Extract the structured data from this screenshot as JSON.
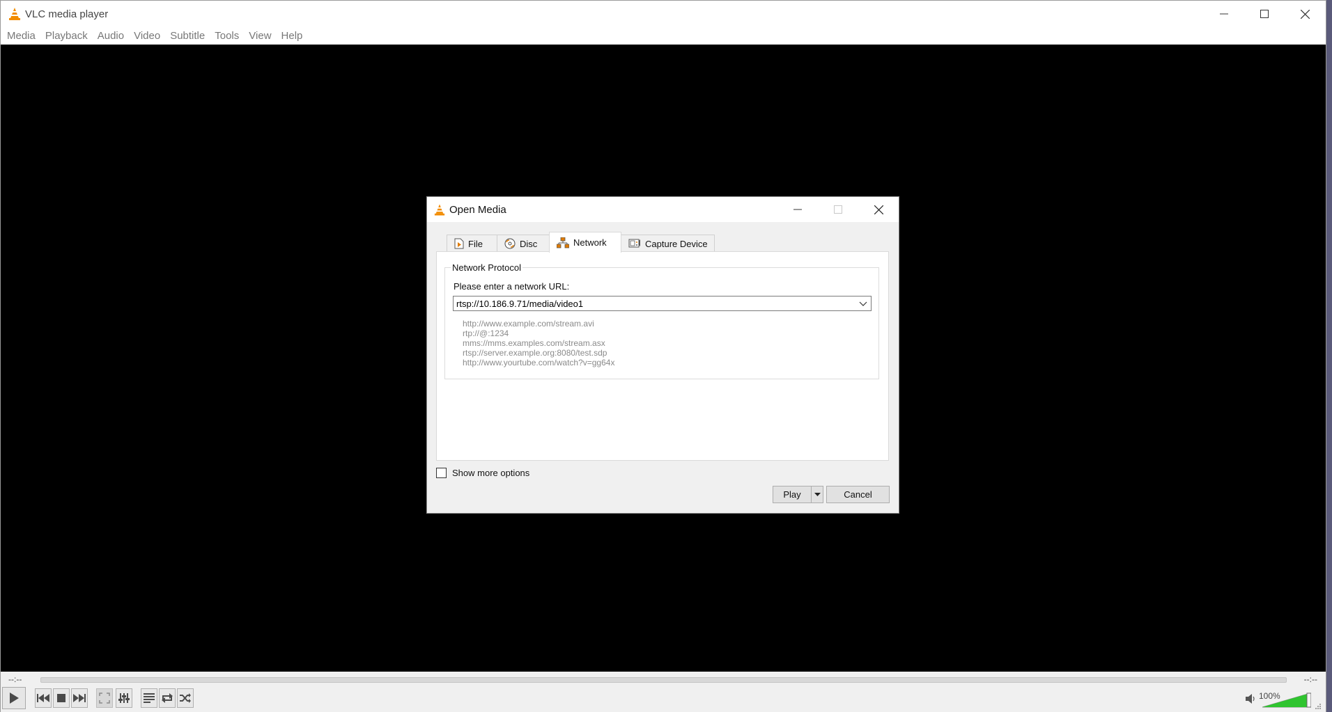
{
  "app": {
    "title": "VLC media player"
  },
  "menubar": {
    "items": [
      "Media",
      "Playback",
      "Audio",
      "Video",
      "Subtitle",
      "Tools",
      "View",
      "Help"
    ]
  },
  "player": {
    "elapsed": "--:--",
    "remaining": "--:--",
    "volume_label": "100%",
    "volume_level": 1.0,
    "seek_position": 0
  },
  "dialog": {
    "title": "Open Media",
    "tabs": [
      {
        "label": "File",
        "icon": "file-icon",
        "active": false
      },
      {
        "label": "Disc",
        "icon": "disc-icon",
        "active": false
      },
      {
        "label": "Network",
        "icon": "network-icon",
        "active": true
      },
      {
        "label": "Capture Device",
        "icon": "capture-device-icon",
        "active": false
      }
    ],
    "group_title": "Network Protocol",
    "url_label": "Please enter a network URL:",
    "url_value": "rtsp://10.186.9.71/media/video1",
    "examples": [
      "http://www.example.com/stream.avi",
      "rtp://@:1234",
      "mms://mms.examples.com/stream.asx",
      "rtsp://server.example.org:8080/test.sdp",
      "http://www.yourtube.com/watch?v=gg64x"
    ],
    "show_more_options": "Show more options",
    "show_more_checked": false,
    "play_label": "Play",
    "cancel_label": "Cancel"
  },
  "colors": {
    "vlc_orange": "#f28c00",
    "video_bg": "#000000",
    "volume_green": "#2fc42f"
  }
}
